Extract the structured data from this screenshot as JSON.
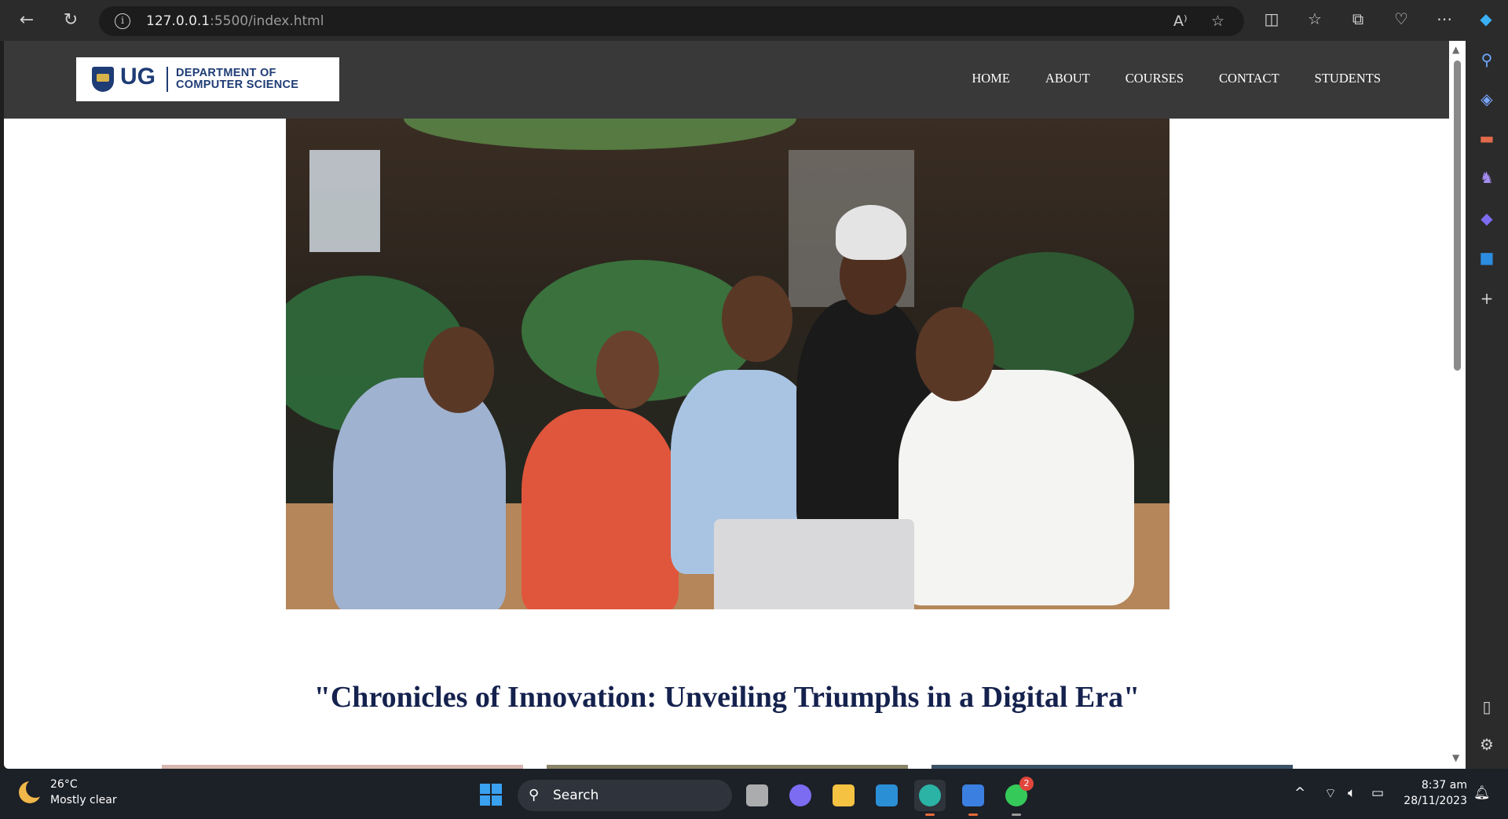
{
  "browser": {
    "url_host": "127.0.0.1",
    "url_path": ":5500/index.html"
  },
  "site": {
    "logo_ug": "UG",
    "logo_dept_line1": "DEPARTMENT OF",
    "logo_dept_line2": "COMPUTER SCIENCE",
    "menu": [
      "HOME",
      "ABOUT",
      "COURSES",
      "CONTACT",
      "STUDENTS"
    ],
    "headline": "\"Chronicles of Innovation: Unveiling Triumphs in a Digital Era\""
  },
  "taskbar": {
    "weather_temp": "26°C",
    "weather_desc": "Mostly clear",
    "search_label": "Search",
    "whatsapp_badge": "2",
    "time": "8:37 am",
    "date": "28/11/2023"
  },
  "colors": {
    "header_bg": "#3a3939",
    "headline": "#15224e",
    "logo_blue": "#1e3c75"
  }
}
